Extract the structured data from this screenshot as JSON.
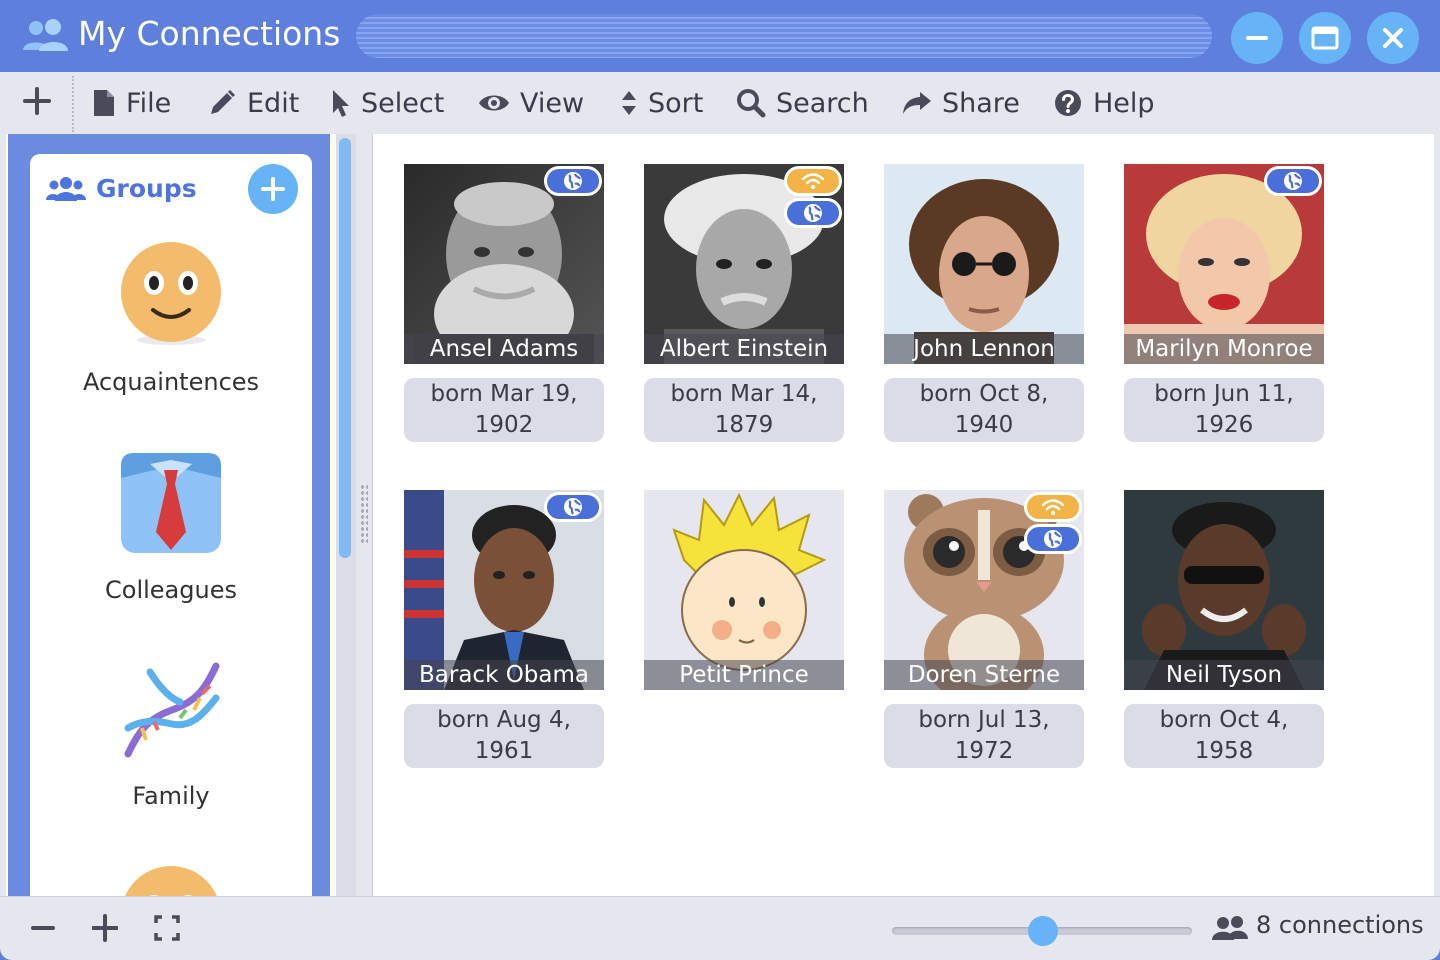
{
  "window": {
    "title": "My Connections",
    "colors": {
      "titlebar": "#5f7fdc",
      "accent": "#66b4f5",
      "badge_web": "#4b6fd8",
      "badge_wifi": "#f2b347"
    }
  },
  "toolbar": {
    "add_icon": "plus-icon",
    "menus": [
      {
        "label": "File",
        "icon": "file-icon"
      },
      {
        "label": "Edit",
        "icon": "pencil-icon"
      },
      {
        "label": "Select",
        "icon": "cursor-icon"
      },
      {
        "label": "View",
        "icon": "eye-icon"
      },
      {
        "label": "Sort",
        "icon": "sort-icon"
      },
      {
        "label": "Search",
        "icon": "search-icon"
      },
      {
        "label": "Share",
        "icon": "share-icon"
      },
      {
        "label": "Help",
        "icon": "help-icon"
      }
    ]
  },
  "sidebar": {
    "title": "Groups",
    "groups": [
      {
        "label": "Acquaintences",
        "icon": "smiley-icon"
      },
      {
        "label": "Colleagues",
        "icon": "shirt-tie-icon"
      },
      {
        "label": "Family",
        "icon": "dna-icon"
      }
    ]
  },
  "connections": [
    {
      "name": "Ansel Adams",
      "born": "born Mar 19, 1902",
      "born_l1": "born Mar 19,",
      "born_l2": "1902",
      "badges": [
        "web"
      ]
    },
    {
      "name": "Albert Einstein",
      "born": "born Mar 14, 1879",
      "born_l1": "born Mar 14,",
      "born_l2": "1879",
      "badges": [
        "wifi",
        "web"
      ]
    },
    {
      "name": "John Lennon",
      "born": "born Oct 8, 1940",
      "born_l1": "born Oct 8,",
      "born_l2": "1940",
      "badges": []
    },
    {
      "name": "Marilyn Monroe",
      "born": "born Jun 11, 1926",
      "born_l1": "born Jun 11,",
      "born_l2": "1926",
      "badges": [
        "web"
      ]
    },
    {
      "name": "Barack Obama",
      "born": "born Aug 4, 1961",
      "born_l1": "born Aug 4,",
      "born_l2": "1961",
      "badges": [
        "web"
      ]
    },
    {
      "name": "Petit Prince",
      "born": "",
      "born_l1": "",
      "born_l2": "",
      "badges": []
    },
    {
      "name": "Doren Sterne",
      "born": "born Jul 13, 1972",
      "born_l1": "born Jul 13,",
      "born_l2": "1972",
      "badges": [
        "wifi",
        "web"
      ]
    },
    {
      "name": "Neil Tyson",
      "born": "born Oct 4, 1958",
      "born_l1": "born Oct 4,",
      "born_l2": "1958",
      "badges": []
    }
  ],
  "statusbar": {
    "zoom_level": 0.5,
    "connections_count": "8 connections"
  }
}
